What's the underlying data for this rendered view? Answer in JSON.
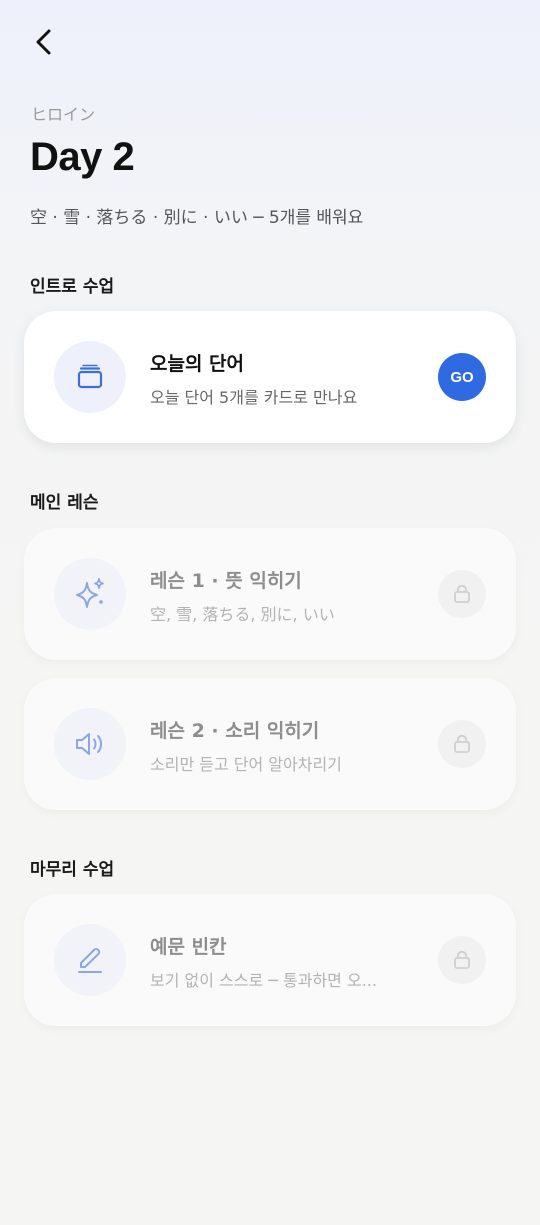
{
  "header": {
    "back_icon": "chevron-left-icon",
    "subtitle": "ヒロイン",
    "title": "Day 2",
    "description": "空 · 雪 · 落ちる · 別に · いい ─ 5개를 배워요"
  },
  "sections": {
    "intro": {
      "title": "인트로 수업",
      "card": {
        "title": "오늘의 단어",
        "subtitle": "오늘 단어 5개를 카드로 만나요",
        "icon": "cards-icon",
        "action_label": "GO",
        "locked": false
      }
    },
    "main": {
      "title": "메인 레슨",
      "cards": [
        {
          "title": "레슨 1 · 뜻 익히기",
          "subtitle": "空, 雪, 落ちる, 別に, いい",
          "icon": "sparkle-icon",
          "locked": true
        },
        {
          "title": "레슨 2 · 소리 익히기",
          "subtitle": "소리만 듣고 단어 알아차리기",
          "icon": "speaker-icon",
          "locked": true
        }
      ]
    },
    "finish": {
      "title": "마무리 수업",
      "card": {
        "title": "예문 빈칸",
        "subtitle": "보기 없이 스스로 ─ 통과하면 오...",
        "icon": "pencil-icon",
        "locked": true
      }
    }
  },
  "colors": {
    "accent": "#2f6ae0",
    "icon_blue": "#3f6fd6",
    "icon_blue_muted": "#8aa6e6"
  }
}
